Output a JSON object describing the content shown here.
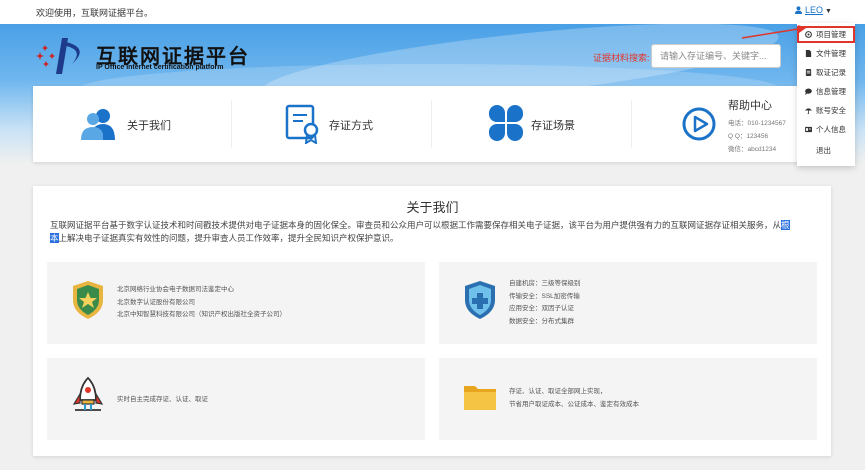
{
  "topbar": {
    "welcome": "欢迎使用，互联网证据平台。",
    "user_name": "LEO"
  },
  "header": {
    "logo_title": "互联网证据平台",
    "logo_subtitle": "IP Office Internet certification platform",
    "search_label": "证据材料搜索:",
    "search_placeholder": "请输入存证编号、关键字...",
    "search_value": ""
  },
  "nav": {
    "items": [
      {
        "label": "关于我们",
        "icon": "users-icon"
      },
      {
        "label": "存证方式",
        "icon": "certificate-icon"
      },
      {
        "label": "存证场景",
        "icon": "apps-icon"
      }
    ],
    "help": {
      "title": "帮助中心",
      "phone": "电话：010-1234567",
      "qq": "Q  Q：123456",
      "wechat": "微信：abcd1234",
      "icon": "play-circle-icon"
    }
  },
  "user_menu": {
    "items": [
      {
        "label": "项目管理",
        "icon": "network-icon"
      },
      {
        "label": "文件管理",
        "icon": "file-icon"
      },
      {
        "label": "取证记录",
        "icon": "list-icon"
      },
      {
        "label": "信息管理",
        "icon": "chat-icon"
      },
      {
        "label": "账号安全",
        "icon": "umbrella-icon"
      },
      {
        "label": "个人信息",
        "icon": "id-card-icon"
      },
      {
        "label": "退出",
        "icon": ""
      }
    ],
    "highlight_color": "#e0352b"
  },
  "about": {
    "title": "关于我们",
    "text_before": "互联网证据平台基于数字认证技术和时间戳技术提供对电子证据本身的固化保全。审查员和公众用户可以根据工作需要保存相关电子证据，该平台为用户提供强有力的互联网证据存证相关服务，从",
    "text_highlight_1": "根",
    "text_highlight_2": "本",
    "text_after": "上解决电子证据真实有效性的问题，提升审查人员工作效率，提升全民知识产权保护意识。",
    "features": [
      {
        "icon": "shield-star-icon",
        "lines": [
          "北京网络行业协会电子数据司法鉴定中心",
          "北京数字认证股份有限公司",
          "北京中知智慧科技有限公司（知识产权出版社全资子公司）"
        ]
      },
      {
        "icon": "shield-plus-icon",
        "lines": [
          "自建机房：三级等保级别",
          "传输安全：SSL加密传输",
          "应用安全：双因子认证",
          "数据安全：分布式集群"
        ]
      },
      {
        "icon": "rocket-icon",
        "lines": [
          "实时自主完成存证、认证、取证"
        ]
      },
      {
        "icon": "folder-icon",
        "lines": [
          "存证、认证、取证全部网上实现，",
          "节省用户取证成本、公证成本、鉴定有效成本"
        ]
      }
    ]
  },
  "colors": {
    "accent_blue": "#1a73c8",
    "banner_blue": "#4aa0e6",
    "search_label_red": "#e0352b"
  }
}
